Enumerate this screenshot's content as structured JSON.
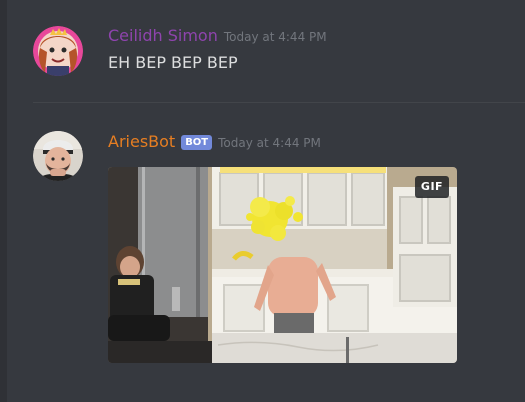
{
  "messages": [
    {
      "author": "Ceilidh Simon",
      "timestamp": "Today at 4:44 PM",
      "text": "EH BEP BEP BEP",
      "author_color": "#8e44ad"
    },
    {
      "author": "AriesBot",
      "bot_tag": "BOT",
      "timestamp": "Today at 4:44 PM",
      "author_color": "#e67e22",
      "embed": {
        "type": "gif",
        "badge": "GIF"
      }
    }
  ],
  "colors": {
    "background": "#36393f",
    "bot_tag": "#7289da",
    "timestamp": "#72767d",
    "text": "#dcddde"
  }
}
